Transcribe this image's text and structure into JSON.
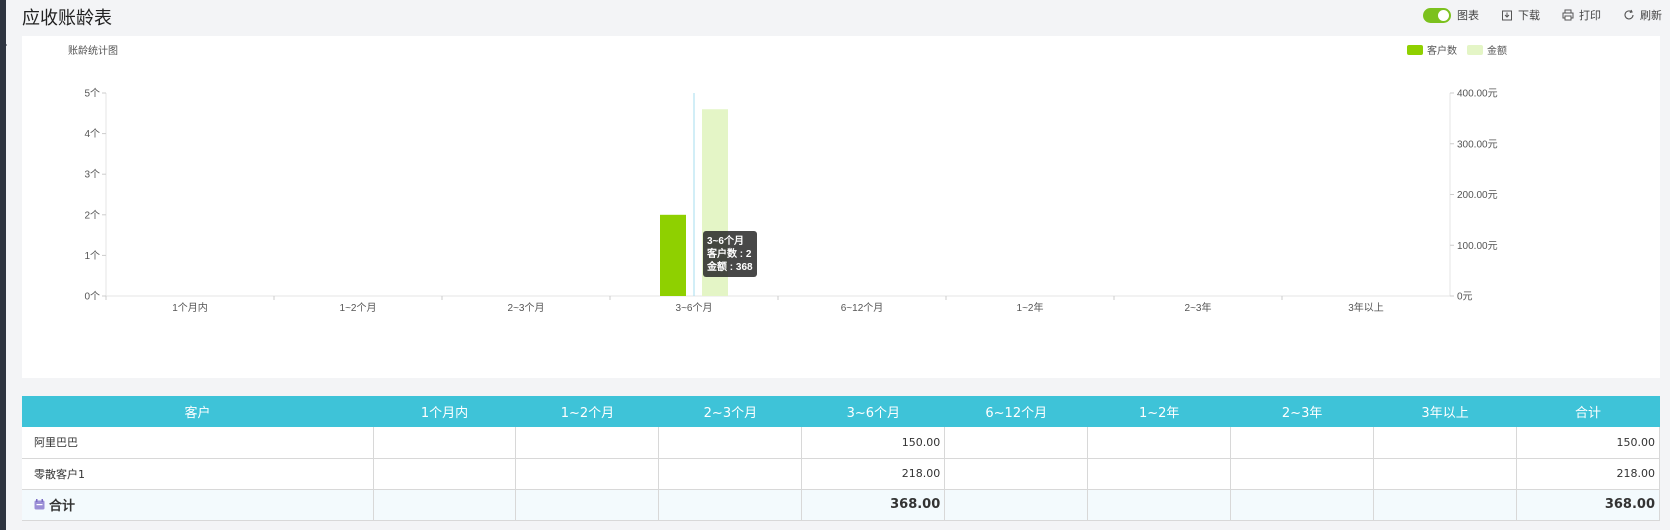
{
  "header": {
    "title": "应收账龄表",
    "toolbar": {
      "chart_toggle_label": "图表",
      "download_label": "下载",
      "print_label": "打印",
      "refresh_label": "刷新"
    }
  },
  "chart_data": {
    "type": "bar",
    "title": "账龄统计图",
    "categories": [
      "1个月内",
      "1~2个月",
      "2~3个月",
      "3~6个月",
      "6~12个月",
      "1~2年",
      "2~3年",
      "3年以上"
    ],
    "series": [
      {
        "name": "客户数",
        "axis": "left",
        "color": "#8fd000",
        "values": [
          0,
          0,
          0,
          2,
          0,
          0,
          0,
          0
        ]
      },
      {
        "name": "金额",
        "axis": "right",
        "color": "#e4f5c6",
        "values": [
          0,
          0,
          0,
          368,
          0,
          0,
          0,
          0
        ]
      }
    ],
    "y_left": {
      "ticks": [
        "0个",
        "1个",
        "2个",
        "3个",
        "4个",
        "5个"
      ],
      "ylim": [
        0,
        5
      ]
    },
    "y_right": {
      "ticks": [
        "0元",
        "100.00元",
        "200.00元",
        "300.00元",
        "400.00元"
      ],
      "ylim": [
        0,
        400
      ]
    },
    "legend": "top-right",
    "tooltip": {
      "title": "3~6个月",
      "line1": "客户数 : 2",
      "line2": "金额 : 368",
      "category_index": 3
    }
  },
  "table": {
    "headers": [
      "客户",
      "1个月内",
      "1~2个月",
      "2~3个月",
      "3~6个月",
      "6~12个月",
      "1~2年",
      "2~3年",
      "3年以上",
      "合计"
    ],
    "rows": [
      [
        "阿里巴巴",
        "",
        "",
        "",
        "150.00",
        "",
        "",
        "",
        "",
        "150.00"
      ],
      [
        "零散客户1",
        "",
        "",
        "",
        "218.00",
        "",
        "",
        "",
        "",
        "218.00"
      ]
    ],
    "total": [
      "合计",
      "",
      "",
      "",
      "368.00",
      "",
      "",
      "",
      "",
      "368.00"
    ]
  }
}
